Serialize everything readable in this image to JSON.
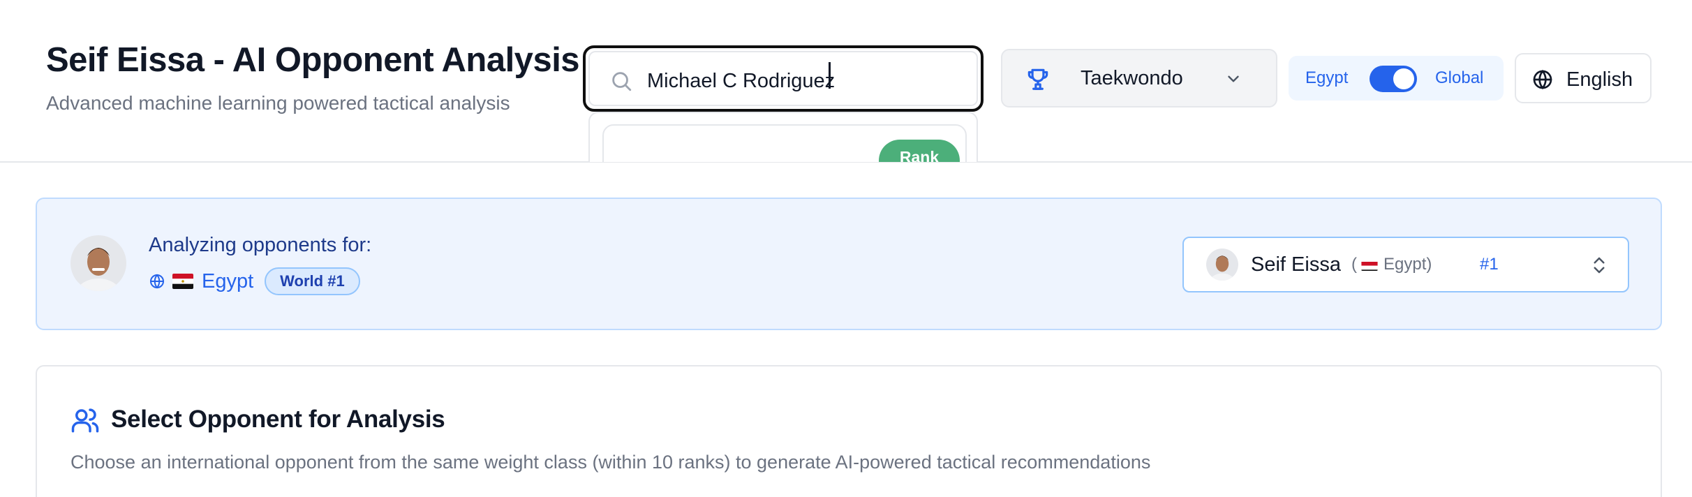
{
  "header": {
    "title": "Seif Eissa - AI Opponent Analysis",
    "subtitle": "Advanced machine learning powered tactical analysis"
  },
  "search": {
    "value": "Michael C Rodriguez",
    "icon": "search-icon",
    "dropdown_peek": {
      "badge": "Rank"
    }
  },
  "sport_select": {
    "value": "Taekwondo",
    "icon": "trophy-icon"
  },
  "region_toggle": {
    "left_label": "Egypt",
    "right_label": "Global",
    "state": "Global",
    "accent": "#2563eb"
  },
  "language": {
    "label": "English",
    "icon": "globe-icon"
  },
  "banner": {
    "heading": "Analyzing opponents for:",
    "country": "Egypt",
    "badge": "World #1",
    "selector": {
      "name": "Seif Eissa",
      "country_open": "(",
      "country": "Egypt)",
      "rank": "#1"
    }
  },
  "opponent_card": {
    "title": "Select Opponent for Analysis",
    "description": "Choose an international opponent from the same weight class (within 10 ranks) to generate AI-powered tactical recommendations"
  },
  "colors": {
    "accent": "#2563eb",
    "rank_green": "#4caf7a",
    "banner_bg": "#eef4fe"
  }
}
